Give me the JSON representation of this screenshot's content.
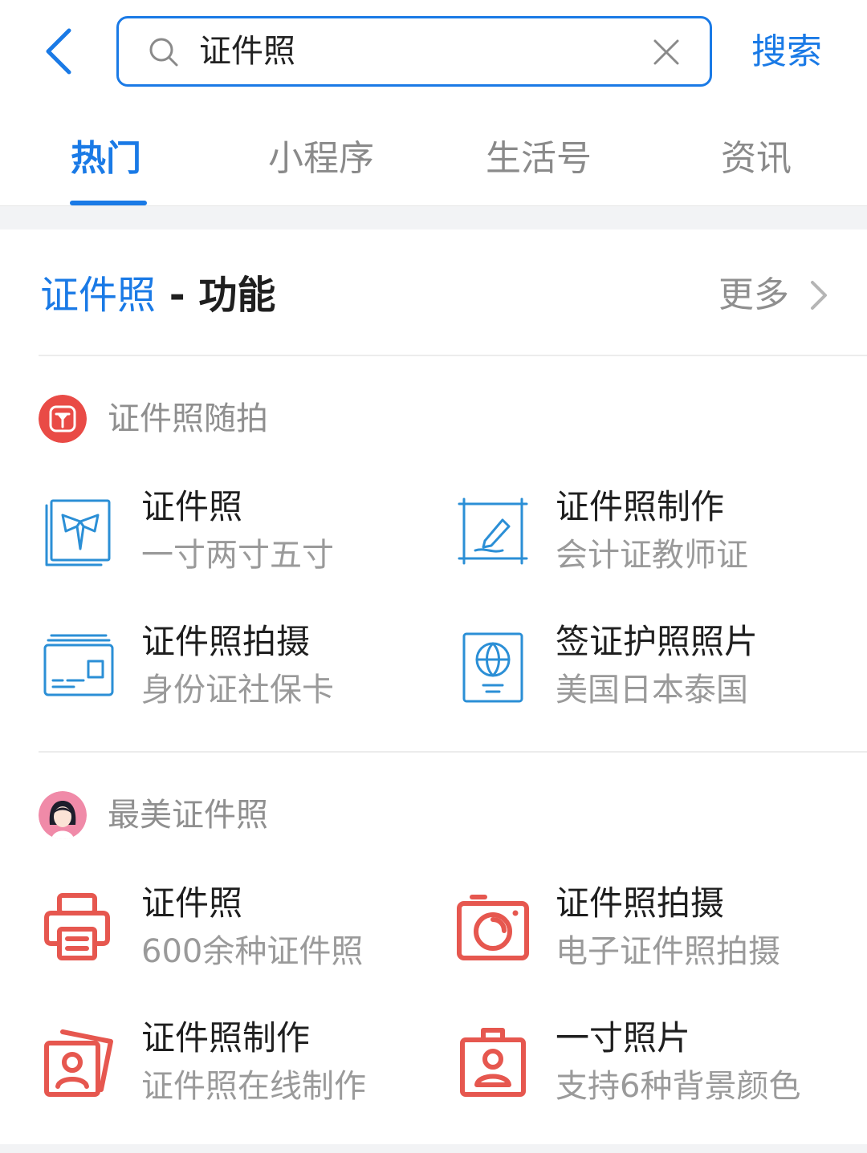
{
  "search": {
    "query": "证件照",
    "button_label": "搜索"
  },
  "tabs": [
    {
      "label": "热门",
      "active": true
    },
    {
      "label": "小程序",
      "active": false
    },
    {
      "label": "生活号",
      "active": false
    },
    {
      "label": "资讯",
      "active": false
    }
  ],
  "section": {
    "keyword": "证件照",
    "title_rest": " - 功能",
    "more_label": "更多"
  },
  "providers": [
    {
      "name": "证件照随拍",
      "logo_color": "#e94b46",
      "items": [
        {
          "title": "证件照",
          "subtitle": "一寸两寸五寸",
          "icon": "shirt-tie-icon"
        },
        {
          "title": "证件照制作",
          "subtitle": "会计证教师证",
          "icon": "signature-frame-icon"
        },
        {
          "title": "证件照拍摄",
          "subtitle": "身份证社保卡",
          "icon": "id-cards-icon"
        },
        {
          "title": "签证护照照片",
          "subtitle": "美国日本泰国",
          "icon": "passport-icon"
        }
      ]
    },
    {
      "name": "最美证件照",
      "logo_color": "#e8466e",
      "items": [
        {
          "title": "证件照",
          "subtitle": "600余种证件照",
          "icon": "printer-icon"
        },
        {
          "title": "证件照拍摄",
          "subtitle": "电子证件照拍摄",
          "icon": "camera-icon"
        },
        {
          "title": "证件照制作",
          "subtitle": "证件照在线制作",
          "icon": "photo-card-icon"
        },
        {
          "title": "一寸照片",
          "subtitle": "支持6种背景颜色",
          "icon": "badge-person-icon"
        }
      ]
    }
  ],
  "colors": {
    "accent": "#1a7ae6",
    "icon_blue": "#2b8fd6",
    "icon_red": "#e6574f"
  }
}
